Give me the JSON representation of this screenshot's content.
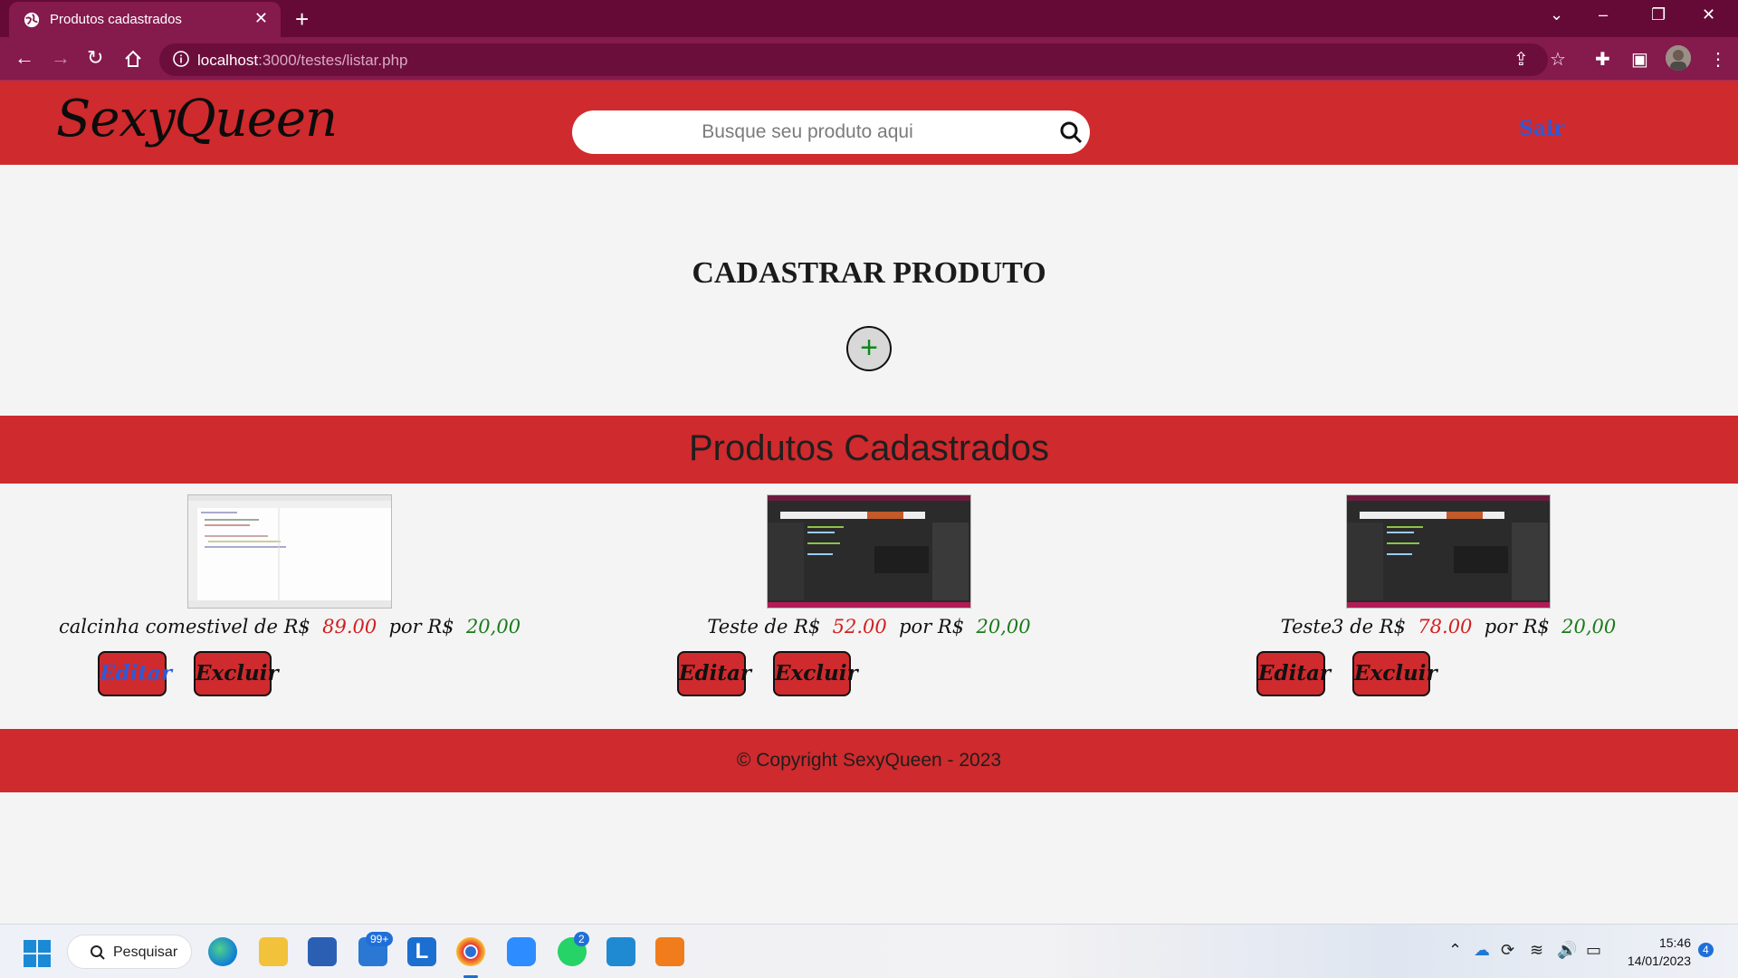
{
  "browser": {
    "tab_title": "Produtos cadastrados",
    "url_host": "localhost",
    "url_rest": ":3000/testes/listar.php"
  },
  "site": {
    "logo": "SexyQueen",
    "search_placeholder": "Busque seu produto aqui",
    "logout_label": "Sair"
  },
  "register": {
    "title": "CADASTRAR PRODUTO",
    "add_symbol": "+"
  },
  "products_section": {
    "title": "Produtos Cadastrados",
    "items": [
      {
        "name_prefix": "calcinha comestivel de R$",
        "old_price": "89.00",
        "by_label": "por R$",
        "new_price": "20,00",
        "edit_label": "Editar",
        "delete_label": "Excluir"
      },
      {
        "name_prefix": "Teste de R$",
        "old_price": "52.00",
        "by_label": "por R$",
        "new_price": "20,00",
        "edit_label": "Editar",
        "delete_label": "Excluir"
      },
      {
        "name_prefix": "Teste3 de R$",
        "old_price": "78.00",
        "by_label": "por R$",
        "new_price": "20,00",
        "edit_label": "Editar",
        "delete_label": "Excluir"
      }
    ]
  },
  "footer": {
    "text": "© Copyright SexyQueen - 2023"
  },
  "taskbar": {
    "search_label": "Pesquisar",
    "mail_badge": "99+",
    "whatsapp_badge": "2",
    "time": "15:46",
    "date": "14/01/2023",
    "notification_count": "4"
  }
}
